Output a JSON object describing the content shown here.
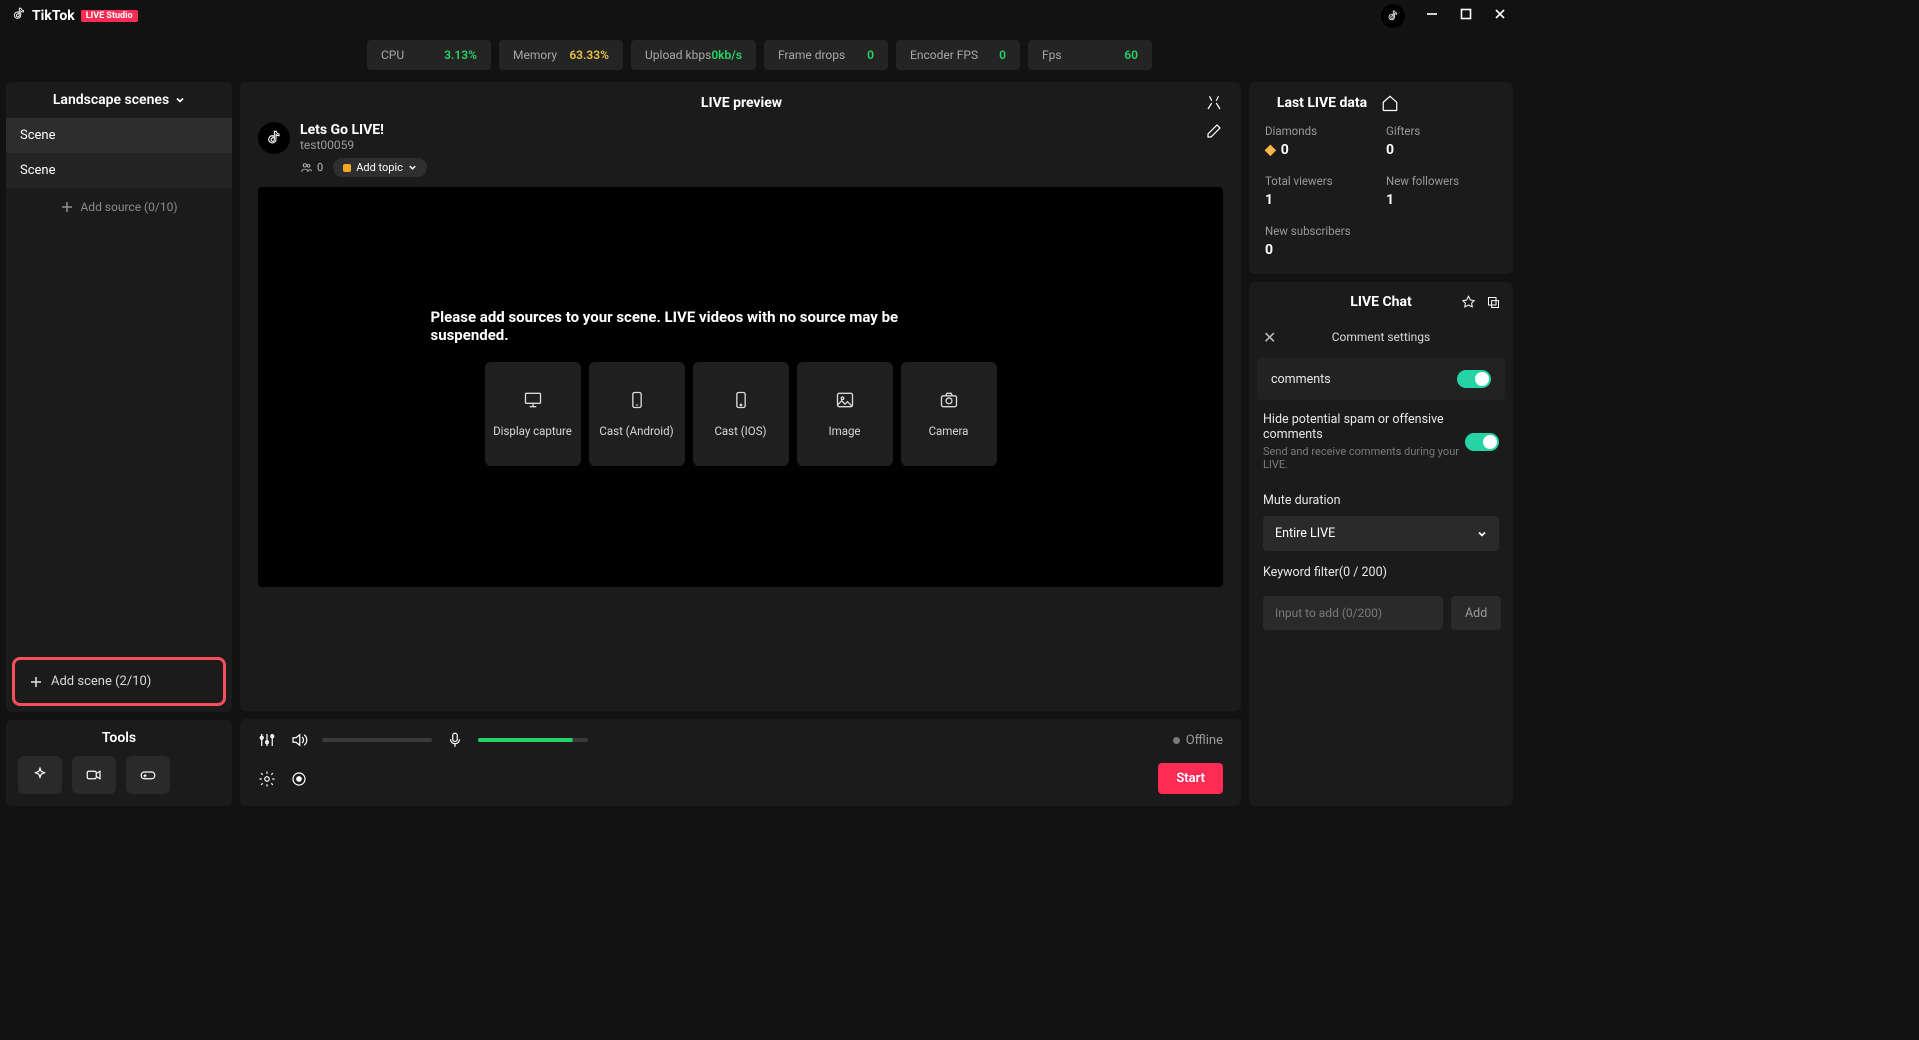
{
  "titlebar": {
    "app_name": "TikTok",
    "badge": "LIVE Studio"
  },
  "stats": [
    {
      "label": "CPU",
      "value": "3.13%",
      "color": "green"
    },
    {
      "label": "Memory",
      "value": "63.33%",
      "color": "yellow"
    },
    {
      "label": "Upload kbps",
      "value": "0kb/s",
      "color": "green"
    },
    {
      "label": "Frame drops",
      "value": "0",
      "color": "green"
    },
    {
      "label": "Encoder FPS",
      "value": "0",
      "color": "green"
    },
    {
      "label": "Fps",
      "value": "60",
      "color": "green"
    }
  ],
  "sidebar": {
    "header": "Landscape scenes",
    "scenes": [
      "Scene",
      "Scene"
    ],
    "add_source": "Add source (0/10)",
    "add_scene": "Add scene (2/10)",
    "tools_title": "Tools"
  },
  "preview": {
    "title": "LIVE preview",
    "stream_title": "Lets Go LIVE!",
    "username": "test00059",
    "viewers": "0",
    "add_topic": "Add topic",
    "empty_msg": "Please add sources to your scene. LIVE videos with no source may be suspended.",
    "sources": [
      "Display capture",
      "Cast (Android)",
      "Cast (IOS)",
      "Image",
      "Camera"
    ]
  },
  "controls": {
    "status": "Offline",
    "start": "Start"
  },
  "live_data": {
    "title": "Last LIVE data",
    "items": [
      {
        "label": "Diamonds",
        "value": "0",
        "icon": "diamond"
      },
      {
        "label": "Gifters",
        "value": "0"
      },
      {
        "label": "Total viewers",
        "value": "1"
      },
      {
        "label": "New followers",
        "value": "1"
      },
      {
        "label": "New subscribers",
        "value": "0"
      }
    ]
  },
  "chat": {
    "title": "LIVE Chat",
    "settings_title": "Comment settings",
    "toggle_comments": "comments",
    "toggle_spam": "Hide potential spam or offensive comments",
    "toggle_spam_sub": "Send and receive comments during your LIVE.",
    "mute_label": "Mute duration",
    "mute_value": "Entire LIVE",
    "keyword_label": "Keyword filter(0 / 200)",
    "keyword_placeholder": "Input to add (0/200)",
    "add_btn": "Add"
  }
}
